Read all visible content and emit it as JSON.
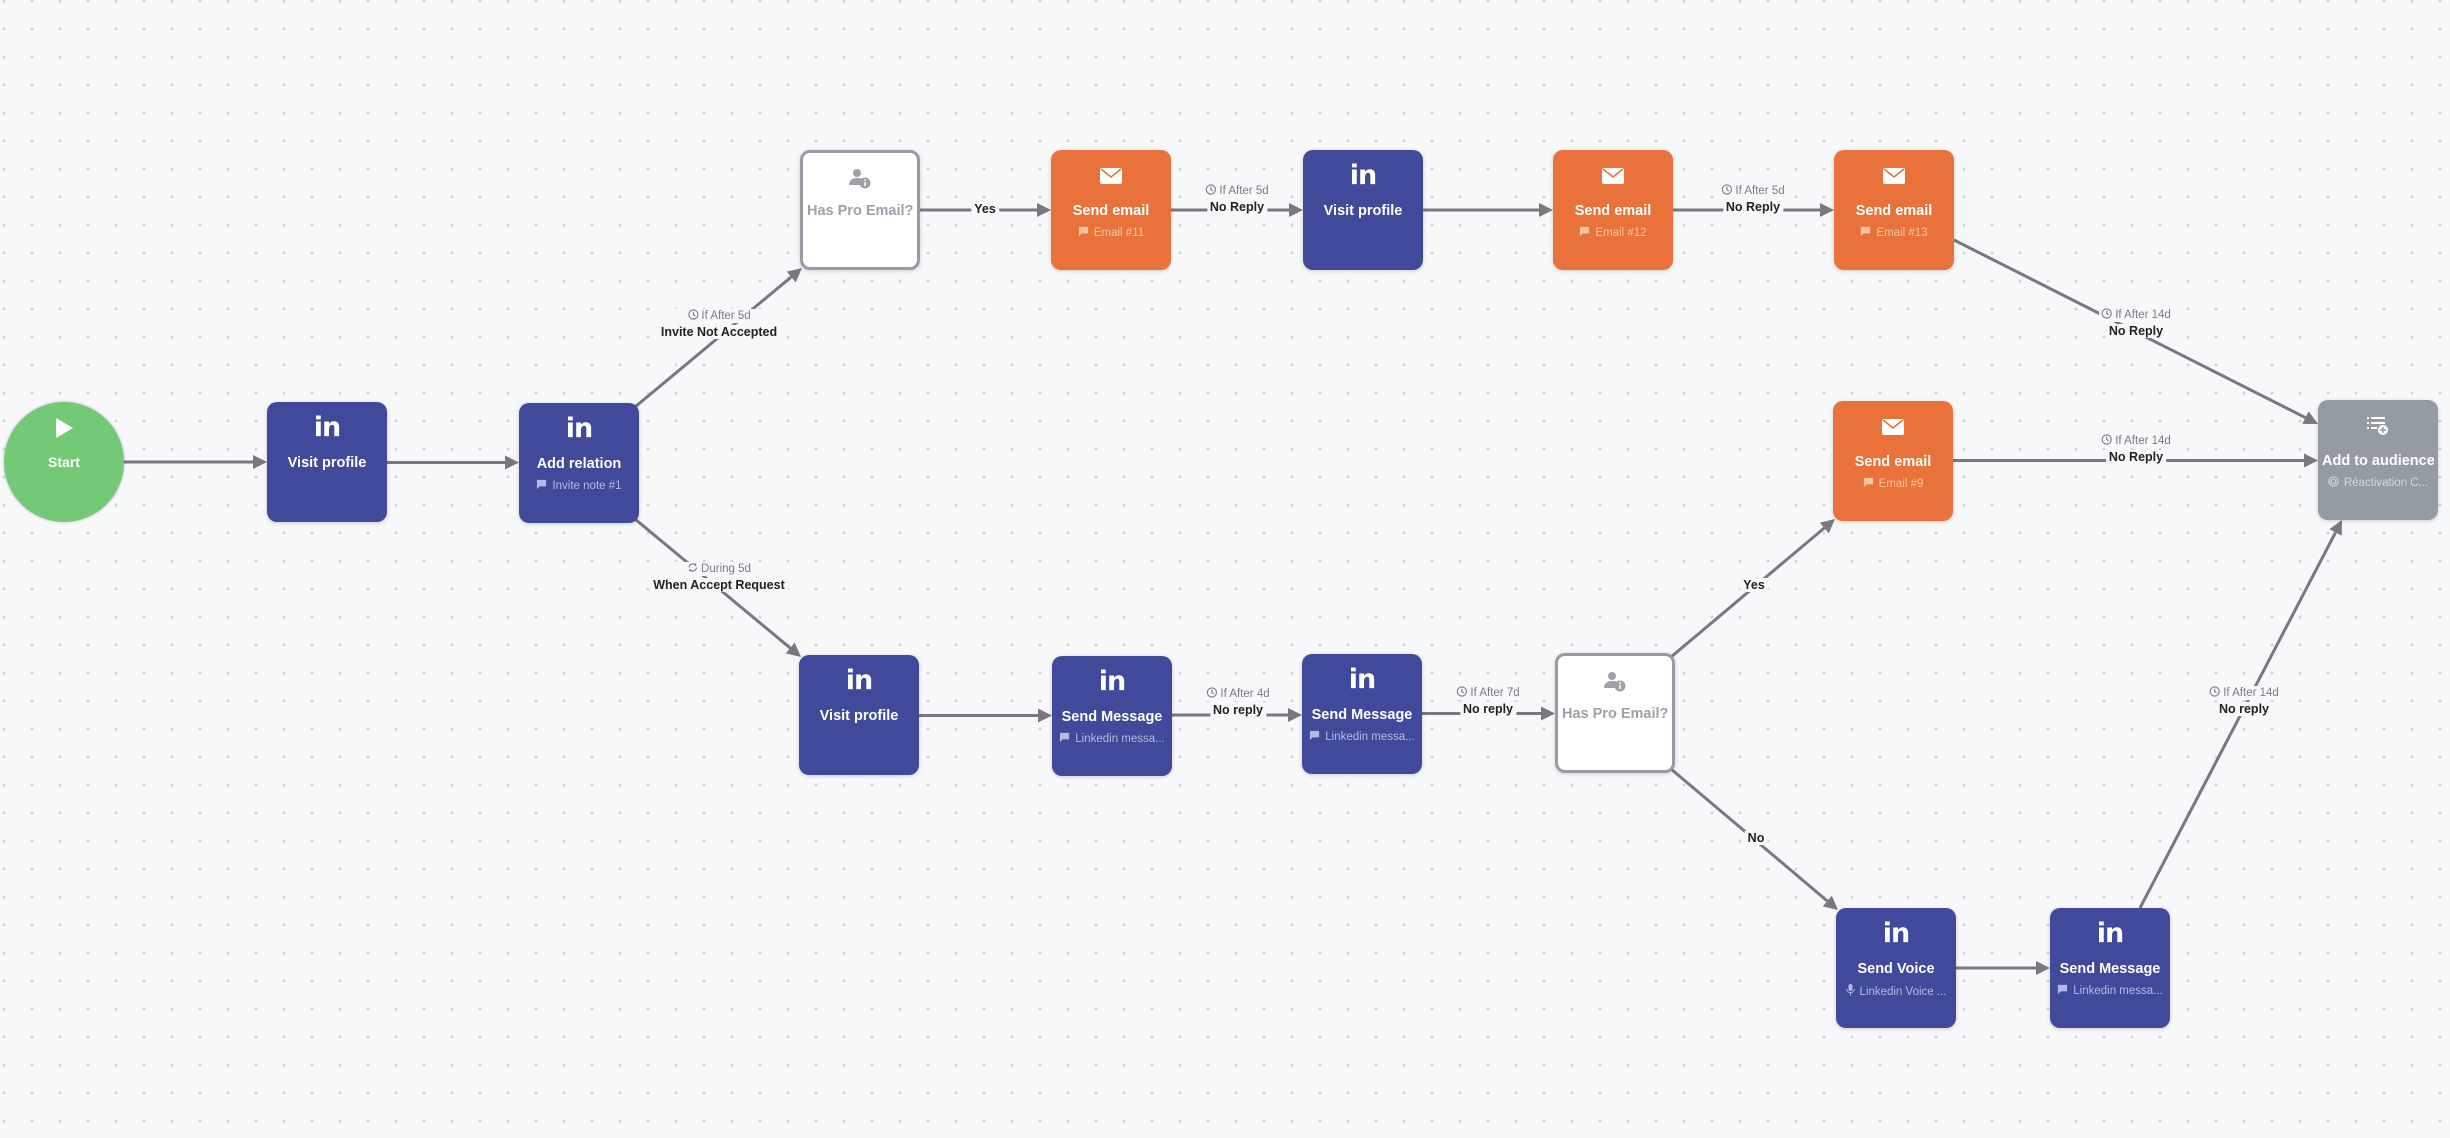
{
  "colors": {
    "linkedin": "#414a9a",
    "email": "#e8723a",
    "condition_border": "#9a9aa2",
    "audience": "#959ba2",
    "start": "#74c976",
    "edge": "#7b7680",
    "canvas": "#f7f8fa"
  },
  "nodes": {
    "start": {
      "type": "start",
      "icon": "play-icon",
      "title": "Start"
    },
    "visit1": {
      "type": "linkedin",
      "icon": "linkedin-icon",
      "title": "Visit profile"
    },
    "addrel": {
      "type": "linkedin",
      "icon": "linkedin-icon",
      "title": "Add relation",
      "sub_icon": "chat-icon",
      "sub": "Invite note #1"
    },
    "haspro_top": {
      "type": "condition",
      "icon": "user-info-icon",
      "title": "Has Pro Email?"
    },
    "email11": {
      "type": "email",
      "icon": "envelope-icon",
      "title": "Send email",
      "sub_icon": "chat-icon",
      "sub": "Email #11"
    },
    "visit_top": {
      "type": "linkedin",
      "icon": "linkedin-icon",
      "title": "Visit profile"
    },
    "email12": {
      "type": "email",
      "icon": "envelope-icon",
      "title": "Send email",
      "sub_icon": "chat-icon",
      "sub": "Email #12"
    },
    "email13": {
      "type": "email",
      "icon": "envelope-icon",
      "title": "Send email",
      "sub_icon": "chat-icon",
      "sub": "Email #13"
    },
    "audience": {
      "type": "audience",
      "icon": "list-add-icon",
      "title": "Add to audience",
      "sub_icon": "audience-icon",
      "sub": "Réactivation C..."
    },
    "email9": {
      "type": "email",
      "icon": "envelope-icon",
      "title": "Send email",
      "sub_icon": "chat-icon",
      "sub": "Email #9"
    },
    "visit_bot": {
      "type": "linkedin",
      "icon": "linkedin-icon",
      "title": "Visit profile"
    },
    "msg1": {
      "type": "linkedin",
      "icon": "linkedin-icon",
      "title": "Send Message",
      "sub_icon": "chat-icon",
      "sub": "Linkedin messa..."
    },
    "msg2": {
      "type": "linkedin",
      "icon": "linkedin-icon",
      "title": "Send Message",
      "sub_icon": "chat-icon",
      "sub": "Linkedin messa..."
    },
    "haspro_bot": {
      "type": "condition",
      "icon": "user-info-icon",
      "title": "Has Pro Email?"
    },
    "voice": {
      "type": "linkedin",
      "icon": "linkedin-icon",
      "title": "Send Voice",
      "sub_icon": "mic-icon",
      "sub": "Linkedin Voice ..."
    },
    "msg3": {
      "type": "linkedin",
      "icon": "linkedin-icon",
      "title": "Send Message",
      "sub_icon": "chat-icon",
      "sub": "Linkedin messa..."
    }
  },
  "edges": {
    "e_start_visit1": {
      "from": "start",
      "to": "visit1"
    },
    "e_visit1_addrel": {
      "from": "visit1",
      "to": "addrel"
    },
    "e_addrel_haspro": {
      "from": "addrel",
      "to": "haspro_top",
      "cond_icon": "clock-icon",
      "cond": "If After 5d",
      "label": "Invite Not Accepted"
    },
    "e_addrel_visitbot": {
      "from": "addrel",
      "to": "visit_bot",
      "cond_icon": "refresh-icon",
      "cond": "During 5d",
      "label": "When Accept Request"
    },
    "e_haspro_email11": {
      "from": "haspro_top",
      "to": "email11",
      "label": "Yes"
    },
    "e_email11_visit": {
      "from": "email11",
      "to": "visit_top",
      "cond_icon": "clock-icon",
      "cond": "If After 5d",
      "label": "No Reply"
    },
    "e_visit_email12": {
      "from": "visit_top",
      "to": "email12"
    },
    "e_email12_email13": {
      "from": "email12",
      "to": "email13",
      "cond_icon": "clock-icon",
      "cond": "If After 5d",
      "label": "No Reply"
    },
    "e_email13_audience": {
      "from": "email13",
      "to": "audience",
      "cond_icon": "clock-icon",
      "cond": "If After 14d",
      "label": "No Reply"
    },
    "e_email9_audience": {
      "from": "email9",
      "to": "audience",
      "cond_icon": "clock-icon",
      "cond": "If After 14d",
      "label": "No Reply"
    },
    "e_visitbot_msg1": {
      "from": "visit_bot",
      "to": "msg1"
    },
    "e_msg1_msg2": {
      "from": "msg1",
      "to": "msg2",
      "cond_icon": "clock-icon",
      "cond": "If After 4d",
      "label": "No reply"
    },
    "e_msg2_haspro": {
      "from": "msg2",
      "to": "haspro_bot",
      "cond_icon": "clock-icon",
      "cond": "If After 7d",
      "label": "No reply"
    },
    "e_haspro_email9": {
      "from": "haspro_bot",
      "to": "email9",
      "label": "Yes"
    },
    "e_haspro_voice": {
      "from": "haspro_bot",
      "to": "voice",
      "label": "No"
    },
    "e_voice_msg3": {
      "from": "voice",
      "to": "msg3"
    },
    "e_msg3_audience": {
      "from": "msg3",
      "to": "audience",
      "cond_icon": "clock-icon",
      "cond": "If After 14d",
      "label": "No reply"
    }
  }
}
